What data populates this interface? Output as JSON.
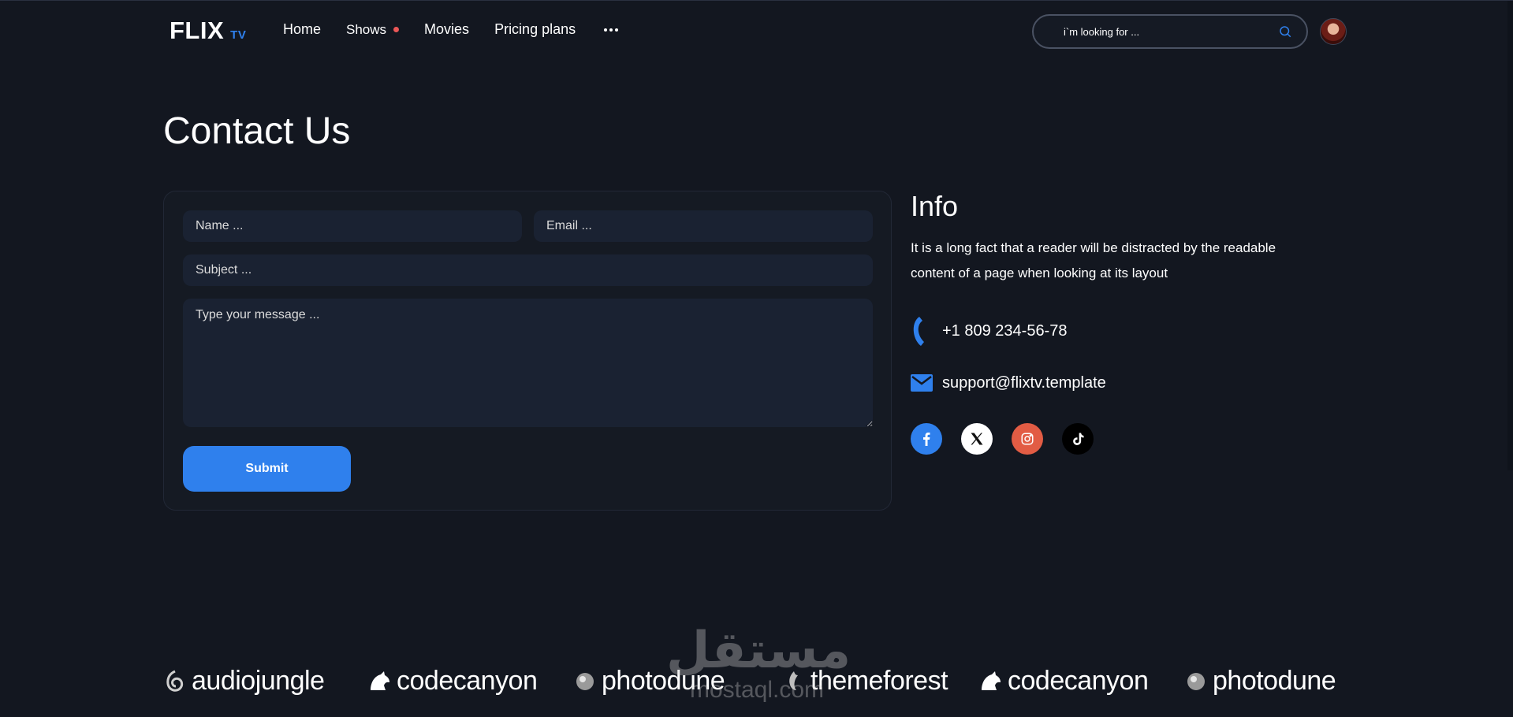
{
  "header": {
    "logo_main": "FLIX",
    "logo_sub": "TV",
    "nav": [
      {
        "label": "Home"
      },
      {
        "label": "Shows"
      },
      {
        "label": "Movies"
      },
      {
        "label": "Pricing plans"
      }
    ],
    "search_placeholder": "i`m looking for ..."
  },
  "page_title": "Contact Us",
  "form": {
    "name_placeholder": "Name ...",
    "email_placeholder": "Email ...",
    "subject_placeholder": "Subject ...",
    "message_placeholder": "Type your message ...",
    "submit_label": "Submit"
  },
  "info": {
    "title": "Info",
    "text": "It is a long fact that a reader will be distracted by the readable content of a page when looking at its layout",
    "phone": "+1 809 234-56-78",
    "email": "support@flixtv.template"
  },
  "socials": [
    {
      "icon": "facebook-icon"
    },
    {
      "icon": "x-twitter-icon"
    },
    {
      "icon": "instagram-icon"
    },
    {
      "icon": "tiktok-icon"
    }
  ],
  "partners": [
    {
      "label": "audiojungle"
    },
    {
      "label": "codecanyon"
    },
    {
      "label": "photodune"
    },
    {
      "label": "themeforest"
    },
    {
      "label": "codecanyon"
    },
    {
      "label": "photodune"
    }
  ],
  "watermark": {
    "arabic": "مستقل",
    "latin": "mostaql.com"
  },
  "colors": {
    "background": "#131720",
    "accent": "#2f80ed",
    "notification_dot": "#eb5757",
    "instagram": "#e25c44"
  }
}
